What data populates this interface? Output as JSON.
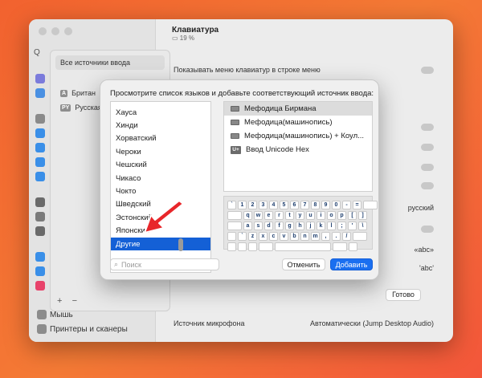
{
  "window": {
    "title": "Клавиатура",
    "subtitle": "19 %",
    "rows": [
      {
        "label": "Показывать меню клавиатур в строке меню"
      }
    ],
    "mic_label": "Источник микрофона",
    "mic_value": "Автоматически (Jump Desktop Audio)",
    "sidebar_bottom": [
      "Мышь",
      "Принтеры и сканеры"
    ],
    "sidebar_search": "Q",
    "right_fragments": [
      "русский",
      "«abc»",
      "'abc'"
    ]
  },
  "input_sheet": {
    "header": "Все источники ввода",
    "items": [
      {
        "badge": "A",
        "label": "Британ"
      },
      {
        "badge": "PY",
        "label": "Русская"
      }
    ],
    "plus": "+",
    "minus": "−",
    "done": "Готово"
  },
  "dialog": {
    "prompt": "Просмотрите список языков и добавьте соответствующий источник ввода:",
    "languages": [
      "Хауса",
      "Хинди",
      "Хорватский",
      "Чероки",
      "Чешский",
      "Чикасо",
      "Чокто",
      "Шведский",
      "Эстонский",
      "Японский",
      "Другие"
    ],
    "selected_language": "Другие",
    "sources": [
      {
        "icon": "keyboard-icon",
        "label": "Мефодица Бирмана"
      },
      {
        "icon": "keyboard-icon",
        "label": "Мефодица(машинопись)"
      },
      {
        "icon": "keyboard-icon",
        "label": "Мефодица(машинопись) + Коул..."
      },
      {
        "icon": "unicode-icon",
        "icon_text": "U+",
        "label": "Ввод Unicode Hex"
      }
    ],
    "keyboard_rows": [
      [
        "`",
        "1",
        "2",
        "3",
        "4",
        "5",
        "6",
        "7",
        "8",
        "9",
        "0",
        "-",
        "="
      ],
      [
        "q",
        "w",
        "e",
        "r",
        "t",
        "y",
        "u",
        "i",
        "o",
        "p",
        "[",
        "]"
      ],
      [
        "a",
        "s",
        "d",
        "f",
        "g",
        "h",
        "j",
        "k",
        "l",
        ";",
        "'",
        "\\"
      ],
      [
        "`",
        "z",
        "x",
        "c",
        "v",
        "b",
        "n",
        "m",
        ",",
        ".",
        "/"
      ]
    ],
    "search_placeholder": "Поиск",
    "cancel": "Отменить",
    "add": "Добавить"
  },
  "colors": {
    "accent": "#1a6ff0",
    "selection": "#1460d6",
    "arrow": "#e8262a"
  }
}
